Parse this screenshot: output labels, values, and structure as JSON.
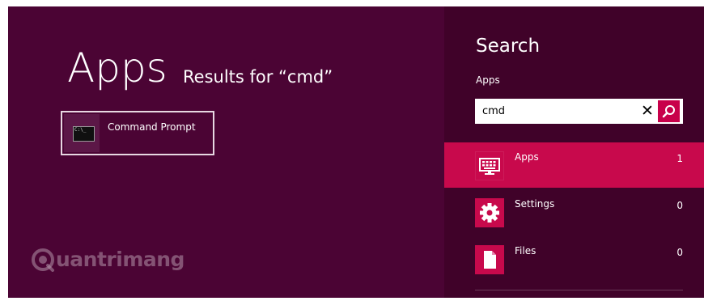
{
  "results": {
    "heading": "Apps",
    "subheading": "Results for “cmd”",
    "items": [
      {
        "label": "Command Prompt",
        "icon": "cmd-icon",
        "icon_text": "C:\\_"
      }
    ]
  },
  "watermark": {
    "text": "uantrimang",
    "logo": "Q"
  },
  "search_pane": {
    "title": "Search",
    "scope": "Apps",
    "query": "cmd",
    "clear_symbol": "✕",
    "filters": [
      {
        "label": "Apps",
        "count": "1",
        "icon": "apps-keyboard-icon",
        "selected": true
      },
      {
        "label": "Settings",
        "count": "0",
        "icon": "settings-gear-icon",
        "selected": false
      },
      {
        "label": "Files",
        "count": "0",
        "icon": "file-icon",
        "selected": false
      }
    ]
  },
  "colors": {
    "background": "#4b0434",
    "pane": "#400229",
    "accent": "#c8094c"
  }
}
